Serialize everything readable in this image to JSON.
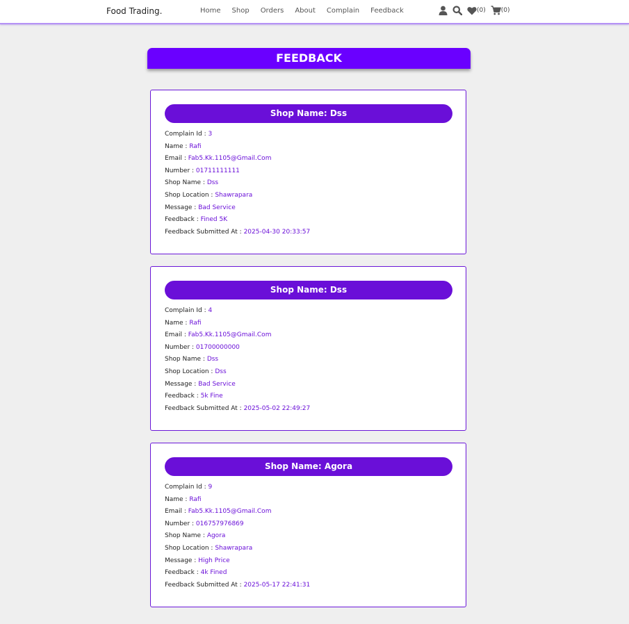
{
  "header": {
    "logo": "Food Trading.",
    "nav": [
      "Home",
      "Shop",
      "Orders",
      "About",
      "Complain",
      "Feedback"
    ],
    "wishlist_count": "(0)",
    "cart_count": "(0)",
    "icons": [
      "user-icon",
      "search-icon",
      "heart-icon",
      "cart-icon"
    ]
  },
  "page": {
    "title": "FEEDBACK"
  },
  "colors": {
    "accent": "#6a00ff",
    "value_text": "#6a0fd8",
    "background": "#efefef"
  },
  "feedbacks": [
    {
      "header": "Shop Name: Dss",
      "fields": [
        {
          "label": "Complain Id : ",
          "value": "3"
        },
        {
          "label": "Name : ",
          "value": "Rafi"
        },
        {
          "label": "Email : ",
          "value": "Fab5.Kk.1105@Gmail.Com"
        },
        {
          "label": "Number : ",
          "value": "01711111111"
        },
        {
          "label": "Shop Name : ",
          "value": "Dss"
        },
        {
          "label": "Shop Location : ",
          "value": "Shawrapara"
        },
        {
          "label": "Message : ",
          "value": "Bad Service"
        },
        {
          "label": "Feedback : ",
          "value": "Fined 5K"
        },
        {
          "label": "Feedback Submitted At : ",
          "value": "2025-04-30 20:33:57"
        }
      ]
    },
    {
      "header": "Shop Name: Dss",
      "fields": [
        {
          "label": "Complain Id : ",
          "value": "4"
        },
        {
          "label": "Name : ",
          "value": "Rafi"
        },
        {
          "label": "Email : ",
          "value": "Fab5.Kk.1105@Gmail.Com"
        },
        {
          "label": "Number : ",
          "value": "01700000000"
        },
        {
          "label": "Shop Name : ",
          "value": "Dss"
        },
        {
          "label": "Shop Location : ",
          "value": "Dss"
        },
        {
          "label": "Message : ",
          "value": "Bad Service"
        },
        {
          "label": "Feedback : ",
          "value": "5k Fine"
        },
        {
          "label": "Feedback Submitted At : ",
          "value": "2025-05-02 22:49:27"
        }
      ]
    },
    {
      "header": "Shop Name: Agora",
      "fields": [
        {
          "label": "Complain Id : ",
          "value": "9"
        },
        {
          "label": "Name : ",
          "value": "Rafi"
        },
        {
          "label": "Email : ",
          "value": "Fab5.Kk.1105@Gmail.Com"
        },
        {
          "label": "Number : ",
          "value": "016757976869"
        },
        {
          "label": "Shop Name : ",
          "value": "Agora"
        },
        {
          "label": "Shop Location : ",
          "value": "Shawrapara"
        },
        {
          "label": "Message : ",
          "value": "High Price"
        },
        {
          "label": "Feedback : ",
          "value": "4k Fined"
        },
        {
          "label": "Feedback Submitted At : ",
          "value": "2025-05-17 22:41:31"
        }
      ]
    }
  ]
}
